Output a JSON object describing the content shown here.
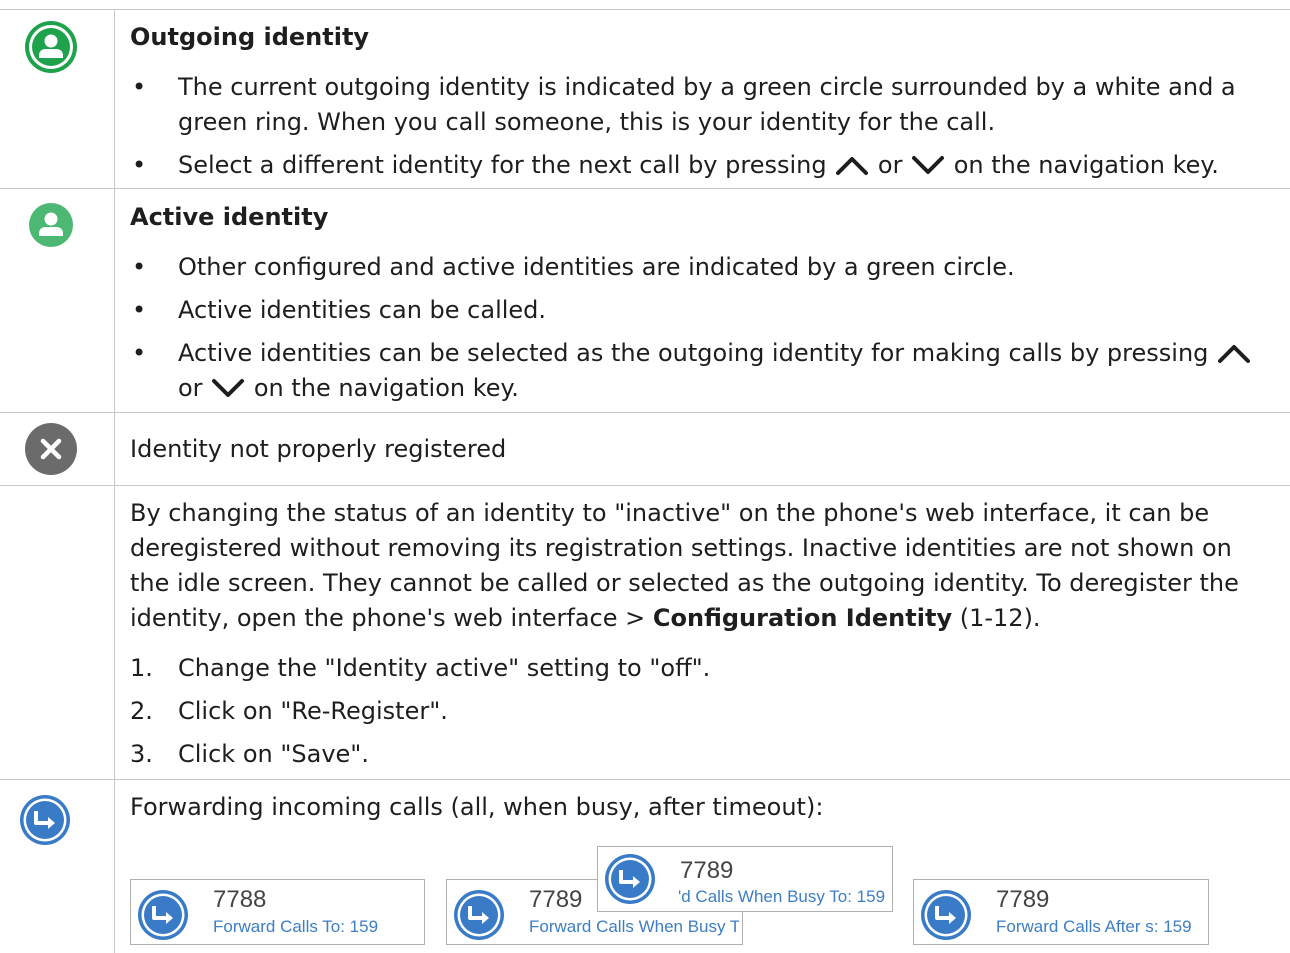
{
  "rows": {
    "outgoing": {
      "title": "Outgoing identity",
      "bullet1": "The current outgoing identity is indicated by a green circle surrounded by a white and a green ring. When you call someone, this is your identity for the call.",
      "bullet2_pre": "Select a different identity for the next call by pressing",
      "bullet2_or": "or",
      "bullet2_post": "on the navigation key."
    },
    "active": {
      "title": "Active identity",
      "bullet1": "Other configured and active identities are indicated by a green circle.",
      "bullet2": "Active identities can be called.",
      "bullet3_pre": "Active identities can be selected as the outgoing identity for making calls by pressing",
      "bullet3_or": "or",
      "bullet3_post": "on the navigation key."
    },
    "not_registered": {
      "text": "Identity not properly registered"
    },
    "inactive": {
      "para_pre": "By changing the status of an identity to \"inactive\" on the phone's web interface, it can be deregistered without removing its registration settings.  Inactive identities are not shown on the idle screen.  They cannot be called or selected as the outgoing identity.  To deregister the identity, open the phone's web interface  >",
      "para_bold": "Configuration Identity",
      "para_post": "(1-12).",
      "steps": [
        {
          "n": "1.",
          "text": "Change the \"Identity active\" setting to \"off\"."
        },
        {
          "n": "2.",
          "text": "Click on \"Re-Register\"."
        },
        {
          "n": "3.",
          "text": "Click on \"Save\"."
        }
      ]
    },
    "forwarding": {
      "text": "Forwarding incoming calls (all, when busy, after timeout):",
      "screens": [
        {
          "number": "7788",
          "label": "Forward Calls To: 159"
        },
        {
          "number": "7789",
          "label": "Forward Calls When Busy T"
        },
        {
          "number": "7789",
          "label": "'d Calls When Busy To: 159"
        },
        {
          "number": "7789",
          "label": "Forward Calls After s: 159"
        }
      ]
    }
  },
  "icons": {
    "outgoing": "person-icon",
    "active": "person-icon",
    "not_registered": "close-icon",
    "forwarding": "forward-arrow-icon",
    "arrow_up": "chevron-up-icon",
    "arrow_down": "chevron-down-icon"
  },
  "colors": {
    "green_dark": "#1fa24c",
    "green_light": "#4cb874",
    "gray": "#6b6b6b",
    "blue": "#3a7bc8",
    "link_blue": "#3d7ec4"
  }
}
